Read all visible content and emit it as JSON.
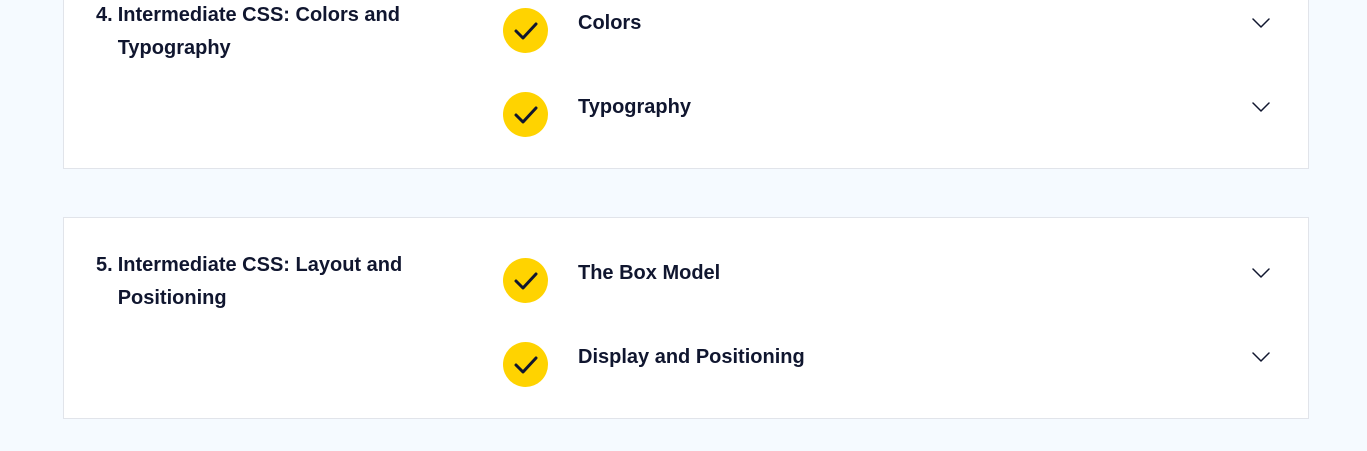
{
  "modules": [
    {
      "number": "4.",
      "title": "Intermediate CSS: Colors and Typography",
      "lessons": [
        {
          "label": "Colors",
          "status_icon": "check-icon",
          "expand_icon": "chevron-down-icon"
        },
        {
          "label": "Typography",
          "status_icon": "check-icon",
          "expand_icon": "chevron-down-icon"
        }
      ]
    },
    {
      "number": "5.",
      "title": "Intermediate CSS: Layout and Positioning",
      "lessons": [
        {
          "label": "The Box Model",
          "status_icon": "check-icon",
          "expand_icon": "chevron-down-icon"
        },
        {
          "label": "Display and Positioning",
          "status_icon": "check-icon",
          "expand_icon": "chevron-down-icon"
        }
      ]
    }
  ],
  "colors": {
    "page_background": "#f5faff",
    "card_background": "#ffffff",
    "card_border": "#e1e4ea",
    "check_fill": "#ffd300",
    "text": "#10162f"
  }
}
